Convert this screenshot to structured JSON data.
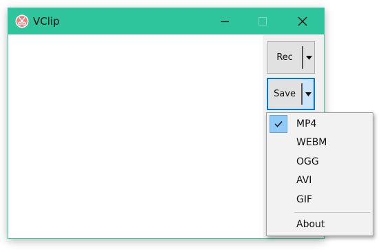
{
  "window": {
    "title": "VClip",
    "icon": "scissors-icon",
    "titlebar_color": "#2ec49c",
    "controls": {
      "minimize": "minimize-icon",
      "maximize": "maximize-icon (disabled)",
      "close": "close-icon"
    }
  },
  "panel": {
    "rec_label": "Rec",
    "save_label": "Save"
  },
  "format_menu": {
    "items": [
      {
        "label": "MP4",
        "checked": true
      },
      {
        "label": "WEBM",
        "checked": false
      },
      {
        "label": "OGG",
        "checked": false
      },
      {
        "label": "AVI",
        "checked": false
      },
      {
        "label": "GIF",
        "checked": false
      }
    ],
    "about_label": "About"
  },
  "colors": {
    "accent": "#2ec49c",
    "focus": "#0078d7",
    "menu_highlight": "#91c9f7"
  }
}
